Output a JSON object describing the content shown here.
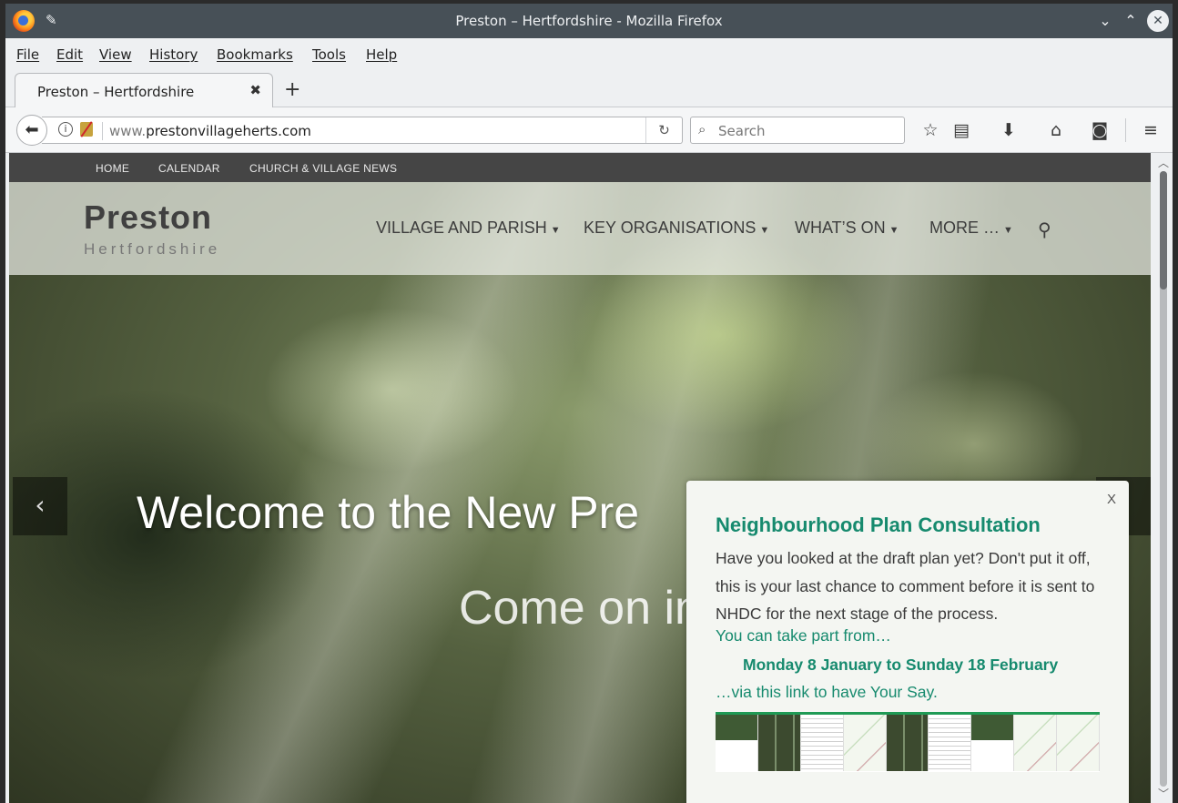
{
  "window": {
    "title": "Preston – Hertfordshire - Mozilla Firefox"
  },
  "menubar": {
    "items": [
      "File",
      "Edit",
      "View",
      "History",
      "Bookmarks",
      "Tools",
      "Help"
    ]
  },
  "tabs": [
    {
      "label": "Preston – Hertfordshire",
      "active": true
    }
  ],
  "navbar": {
    "url_prefix": "www.",
    "url_domain": "prestonvillageherts.com",
    "search_placeholder": "Search"
  },
  "site": {
    "topnav": [
      "HOME",
      "CALENDAR",
      "CHURCH & VILLAGE NEWS"
    ],
    "title": "Preston",
    "subtitle": "Hertfordshire",
    "mainnav": [
      "VILLAGE AND PARISH",
      "KEY ORGANISATIONS",
      "WHAT’S ON",
      "MORE …"
    ]
  },
  "hero": {
    "title": "Welcome to the New Pre",
    "subtitle": "Come on in"
  },
  "popup": {
    "close": "X",
    "title": "Neighbourhood Plan Consultation",
    "body": "Have you looked at the draft plan yet? Don't put it off, this is your last chance to comment before it is sent to NHDC for the next stage of the process.",
    "link1": "You can take part from…",
    "dates": "Monday 8 January to Sunday 18 February",
    "link2": "…via this link to have Your Say."
  },
  "colors": {
    "accent_green": "#168a6e",
    "titlebar": "#475057",
    "topnav": "#454545"
  }
}
